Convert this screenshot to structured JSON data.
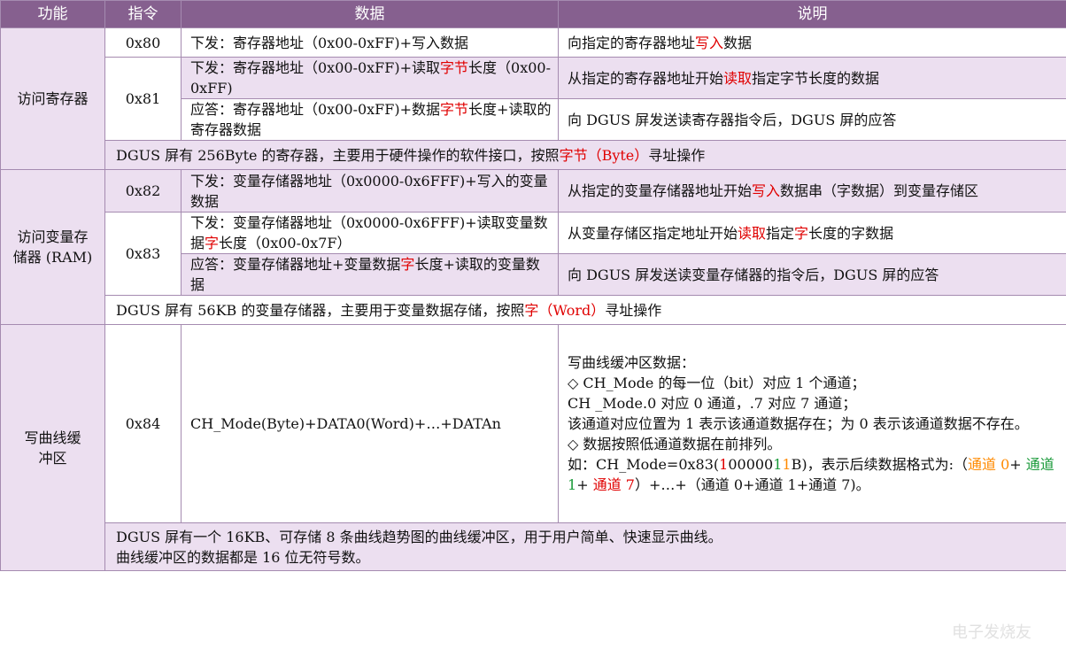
{
  "header": {
    "col_function": "功能",
    "col_command": "指令",
    "col_data": "数据",
    "col_desc": "说明"
  },
  "groups": [
    {
      "function": "访问寄存器",
      "rows": [
        {
          "cmd": "0x80",
          "data": [
            {
              "t": "下发：寄存器地址（0x00-0xFF)+写入数据"
            }
          ],
          "desc": [
            {
              "t": "向指定的寄存器地址"
            },
            {
              "t": "写入",
              "c": "red"
            },
            {
              "t": "数据"
            }
          ]
        },
        {
          "cmd": "0x81",
          "data": [
            {
              "t": "下发：寄存器地址（0x00-0xFF)+读取"
            },
            {
              "t": "字节",
              "c": "red"
            },
            {
              "t": "长度（0x00-0xFF)"
            }
          ],
          "desc": [
            {
              "t": "从指定的寄存器地址开始"
            },
            {
              "t": "读取",
              "c": "red"
            },
            {
              "t": "指定字节长度的数据"
            }
          ]
        },
        {
          "cmd": "",
          "data": [
            {
              "t": "应答：寄存器地址（0x00-0xFF)+数据"
            },
            {
              "t": "字节",
              "c": "red"
            },
            {
              "t": "长度+读取的寄存器数据"
            }
          ],
          "desc": [
            {
              "t": "向 DGUS 屏发送读寄存器指令后，DGUS 屏的应答"
            }
          ]
        }
      ],
      "note": [
        {
          "t": "DGUS 屏有 256Byte 的寄存器，主要用于硬件操作的软件接口，按照"
        },
        {
          "t": "字节（Byte）",
          "c": "red"
        },
        {
          "t": "寻址操作"
        }
      ]
    },
    {
      "function": "访问变量存储器 (RAM)",
      "rows": [
        {
          "cmd": "0x82",
          "data": [
            {
              "t": "下发：变量存储器地址（0x0000-0x6FFF)+写入的变量数据"
            }
          ],
          "desc": [
            {
              "t": "从指定的变量存储器地址开始"
            },
            {
              "t": "写入",
              "c": "red"
            },
            {
              "t": "数据串（字数据）到变量存储区"
            }
          ]
        },
        {
          "cmd": "0x83",
          "data": [
            {
              "t": "下发：变量存储器地址（0x0000-0x6FFF)+读取变量数据"
            },
            {
              "t": "字",
              "c": "red"
            },
            {
              "t": "长度（0x00-0x7F）"
            }
          ],
          "desc": [
            {
              "t": "从变量存储区指定地址开始"
            },
            {
              "t": "读取",
              "c": "red"
            },
            {
              "t": "指定"
            },
            {
              "t": "字",
              "c": "red"
            },
            {
              "t": "长度的字数据"
            }
          ]
        },
        {
          "cmd": "",
          "data": [
            {
              "t": "应答：变量存储器地址+变量数据"
            },
            {
              "t": "字",
              "c": "red"
            },
            {
              "t": "长度+读取的变量数据"
            }
          ],
          "desc": [
            {
              "t": "向 DGUS 屏发送读变量存储器的指令后，DGUS 屏的应答"
            }
          ]
        }
      ],
      "note": [
        {
          "t": "DGUS 屏有 56KB 的变量存储器，主要用于变量数据存储，按照"
        },
        {
          "t": "字（Word）",
          "c": "red"
        },
        {
          "t": "寻址操作"
        }
      ]
    },
    {
      "function": "写曲线缓冲区",
      "rows": [
        {
          "cmd": "0x84",
          "data": [
            {
              "t": "CH_Mode(Byte)+DATA0(Word)+…+DATAn"
            }
          ],
          "desc_lines": [
            [
              {
                "t": "写曲线缓冲区数据："
              }
            ],
            [
              {
                "t": "◇ CH_Mode 的每一位（bit）对应 1 个通道；"
              }
            ],
            [
              {
                "t": "CH _Mode.0 对应 0 通道，.7 对应 7 通道；"
              }
            ],
            [
              {
                "t": "该通道对应位置为 1 表示该通道数据存在；为 0 表示该通道数据不存在。"
              }
            ],
            [
              {
                "t": "◇ 数据按照低通道数据在前排列。"
              }
            ],
            [
              {
                "t": "如：CH_Mode=0x83("
              },
              {
                "t": "1",
                "c": "red"
              },
              {
                "t": "00000"
              },
              {
                "t": "1",
                "c": "green"
              },
              {
                "t": "1",
                "c": "orange"
              },
              {
                "t": "B)，表示后续数据格式为:（"
              },
              {
                "t": "通道 0",
                "c": "orange"
              },
              {
                "t": "+ "
              },
              {
                "t": "通道 1",
                "c": "green"
              },
              {
                "t": "+ "
              },
              {
                "t": "通道 7",
                "c": "red"
              },
              {
                "t": "）+…+（通道 0+通道 1+通道 7)。"
              }
            ]
          ]
        }
      ],
      "note_lines": [
        [
          {
            "t": "DGUS 屏有一个 16KB、可存储 8 条曲线趋势图的曲线缓冲区，用于用户简单、快速显示曲线。"
          }
        ],
        [
          {
            "t": "曲线缓冲区的数据都是 16 位无符号数。"
          }
        ]
      ]
    }
  ],
  "watermark": "电子发烧友"
}
